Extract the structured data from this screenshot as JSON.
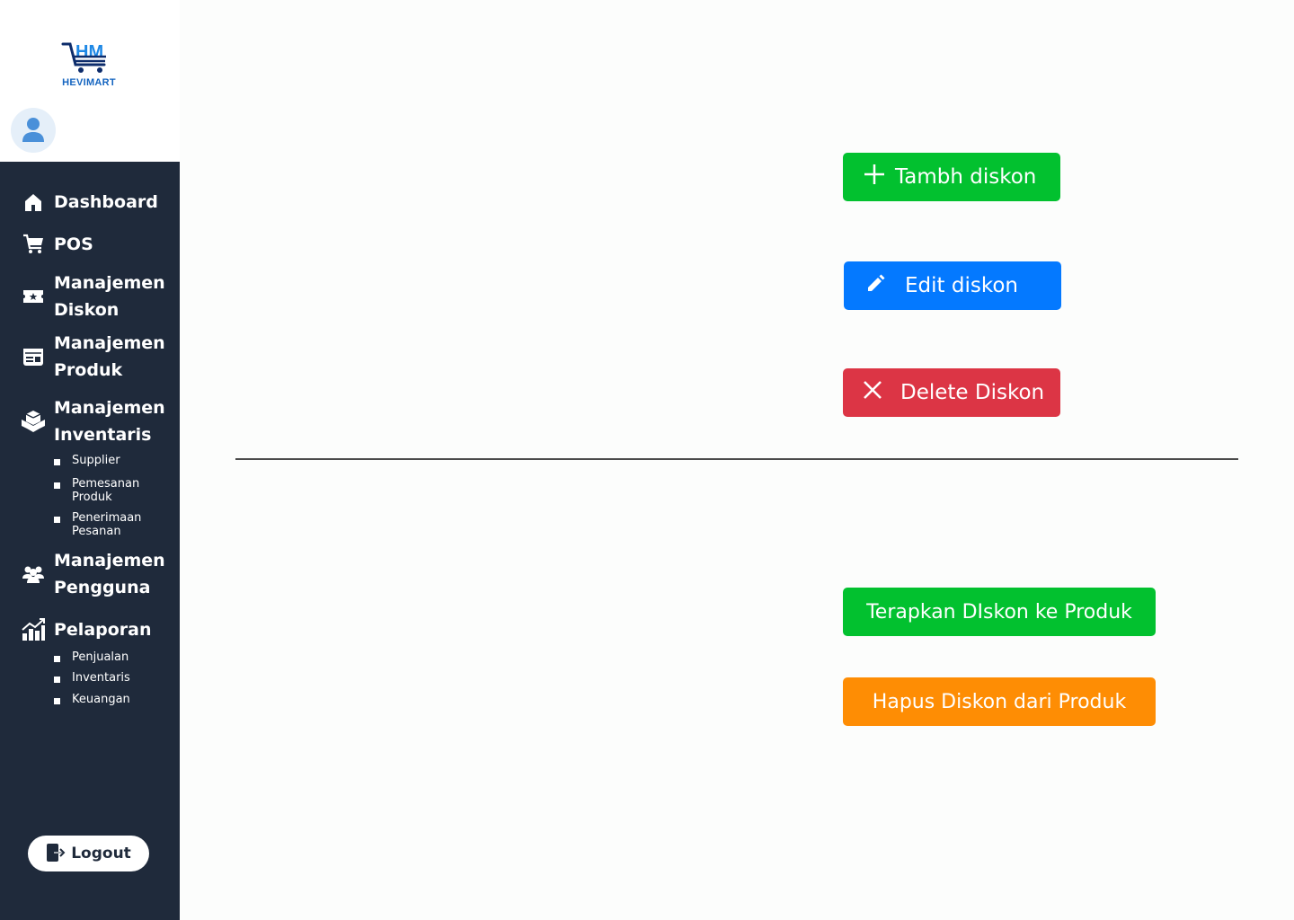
{
  "brand": {
    "name": "HEVIMART",
    "accent": "#1565c0"
  },
  "sidebar": {
    "background": "#1f2a3b",
    "nav": [
      {
        "label": "Dashboard",
        "icon": "home-icon"
      },
      {
        "label": "POS",
        "icon": "cart-icon"
      },
      {
        "label": "Manajemen Diskon",
        "icon": "ticket-icon"
      },
      {
        "label": "Manajemen Produk",
        "icon": "product-icon"
      },
      {
        "label": "Manajemen Inventaris",
        "icon": "boxes-icon"
      },
      {
        "label": "Manajemen Pengguna",
        "icon": "users-icon"
      },
      {
        "label": "Pelaporan",
        "icon": "chart-icon"
      }
    ],
    "inventory_sub": [
      "Supplier",
      "Pemesanan Produk",
      "Penerimaan Pesanan"
    ],
    "report_sub": [
      "Penjualan",
      "Inventaris",
      "Keuangan"
    ],
    "logout_label": "Logout"
  },
  "actions": {
    "add_label": "Tambh diskon",
    "edit_label": "Edit diskon",
    "delete_label": "Delete Diskon",
    "apply_label": "Terapkan DIskon ke Produk",
    "remove_label": "Hapus Diskon dari Produk"
  },
  "colors": {
    "green": "#02c12f",
    "blue": "#0479ff",
    "red": "#dc3545",
    "orange": "#fe8d04"
  }
}
